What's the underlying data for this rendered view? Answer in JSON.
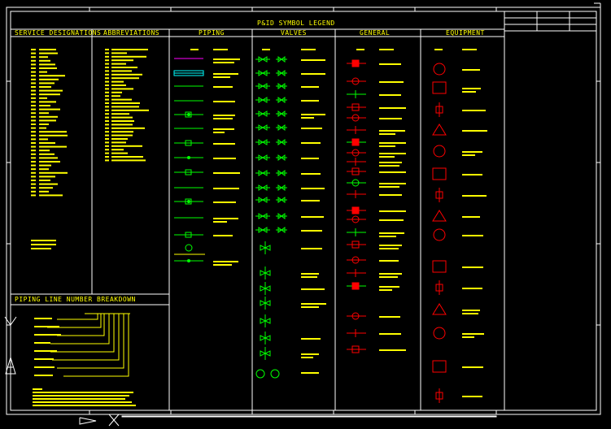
{
  "title": "P&ID SYMBOL LEGEND",
  "sections": {
    "service_designations": "SERVICE DESIGNATIONS",
    "abbreviations": "ABBREVIATIONS",
    "piping": "PIPING",
    "valves": "VALVES",
    "general": "GENERAL",
    "equipment": "EQUIPMENT",
    "line_number": "PIPING LINE NUMBER BREAKDOWN"
  },
  "colors": {
    "frame": "#ffffff",
    "text_yellow": "#ffff00",
    "symbol_green": "#00ff00",
    "symbol_red": "#ff0000",
    "symbol_magenta": "#ff00ff",
    "symbol_cyan": "#00ffff"
  },
  "icons": [
    "ucs-icon",
    "cursor-crosshair"
  ]
}
